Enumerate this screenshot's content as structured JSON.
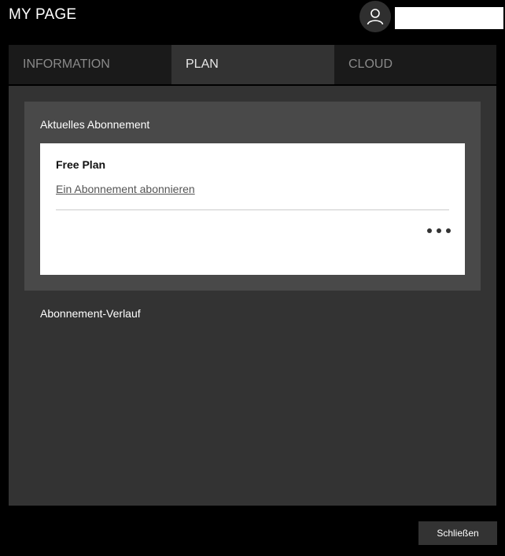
{
  "header": {
    "title": "MY PAGE",
    "user_name": "",
    "avatar_icon": "user-icon"
  },
  "tabs": [
    {
      "label": "INFORMATION",
      "active": false
    },
    {
      "label": "PLAN",
      "active": true
    },
    {
      "label": "CLOUD",
      "active": false
    }
  ],
  "plan": {
    "current_section_title": "Aktuelles Abonnement",
    "plan_name": "Free Plan",
    "subscribe_link": "Ein Abonnement abonnieren",
    "more_icon": "more-horizontal-icon",
    "history_title": "Abonnement-Verlauf"
  },
  "footer": {
    "close_label": "Schließen"
  },
  "colors": {
    "background": "#000000",
    "panel": "#333333",
    "section": "#494949",
    "card": "#ffffff",
    "tab_inactive": "#1a1a1a"
  }
}
